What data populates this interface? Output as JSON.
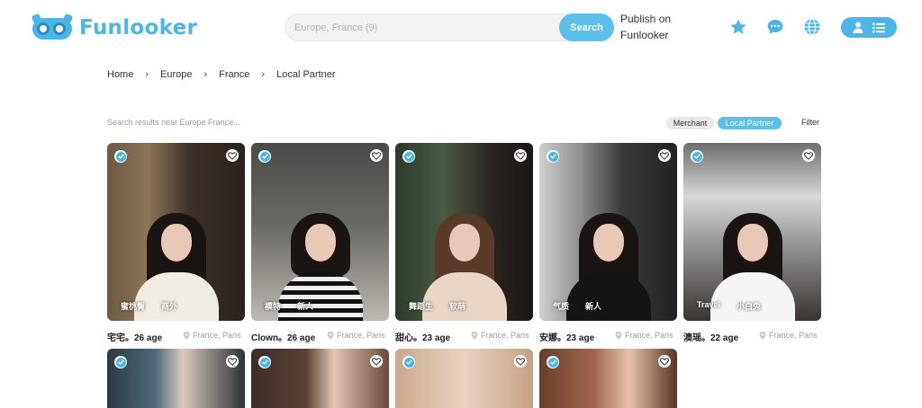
{
  "header": {
    "logo_text": "Funlooker",
    "search": {
      "placeholder": "Europe, France (9)",
      "button_label": "Search"
    },
    "publish_link": "Publish on Funlooker",
    "icons": [
      "star-icon",
      "chat-icon",
      "globe-icon",
      "user-icon",
      "list-icon"
    ],
    "accent_color": "#4cb6e8"
  },
  "breadcrumb": [
    "Home",
    "Europe",
    "France",
    "Local Partner"
  ],
  "results": {
    "text": "Search results near Europe France...",
    "chips": {
      "merchant": "Merchant",
      "local_partner": "Local Partner"
    },
    "filter_label": "Filter"
  },
  "profiles": [
    {
      "name": "宅宅。26 age",
      "location": "France, Paris",
      "tags": [
        "蜜桃臀",
        "商外"
      ]
    },
    {
      "name": "Clown。26 age",
      "location": "France, Paris",
      "tags": [
        "模特",
        "新人"
      ]
    },
    {
      "name": "甜心。23 age",
      "location": "France, Paris",
      "tags": [
        "舞蹈生",
        "软萌"
      ]
    },
    {
      "name": "安娜。23 age",
      "location": "France, Paris",
      "tags": [
        "气质",
        "新人"
      ]
    },
    {
      "name": "澳瑶。22 age",
      "location": "France, Paris",
      "tags": [
        "Travel",
        "小白兔"
      ]
    },
    {
      "name": "",
      "location": "",
      "tags": []
    },
    {
      "name": "",
      "location": "",
      "tags": []
    },
    {
      "name": "",
      "location": "",
      "tags": []
    },
    {
      "name": "",
      "location": "",
      "tags": []
    }
  ]
}
